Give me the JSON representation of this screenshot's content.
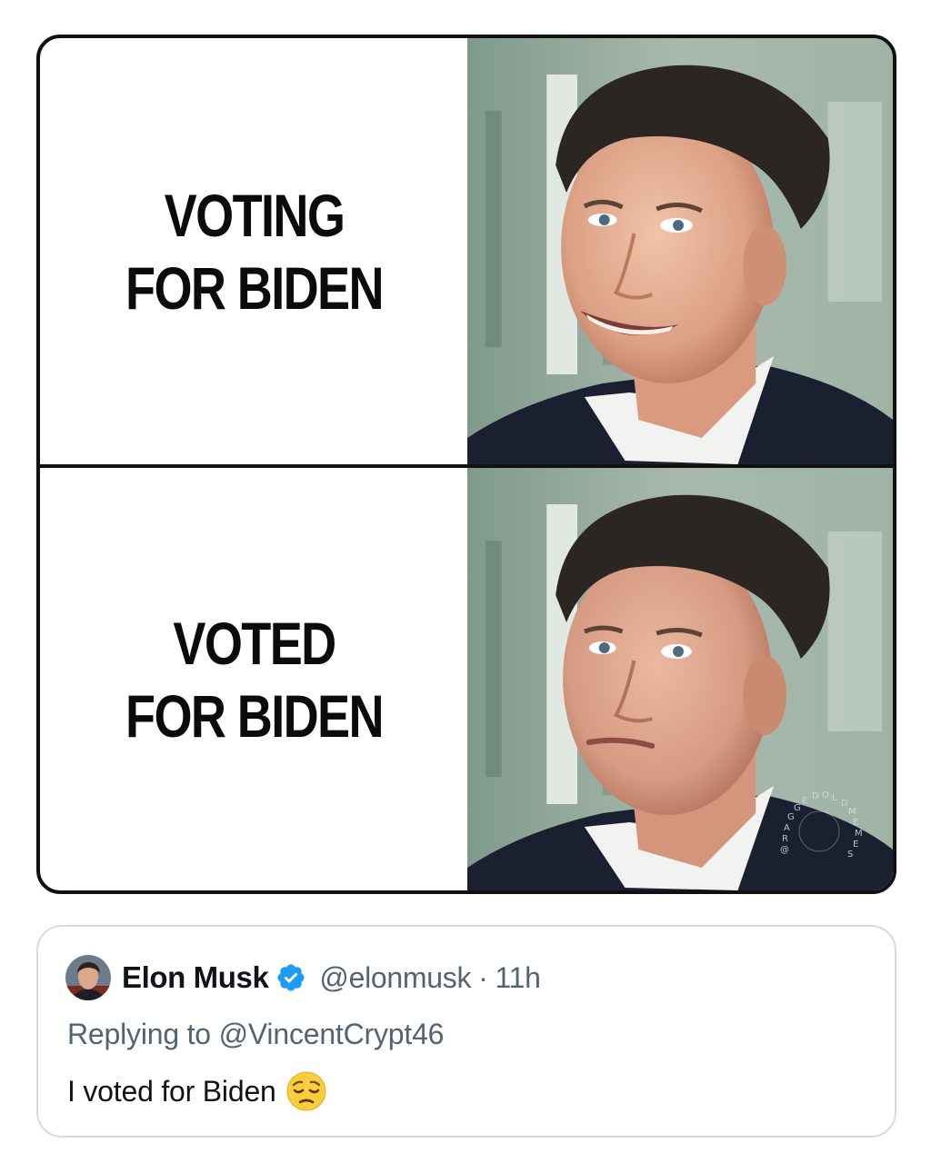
{
  "meme": {
    "top_caption": [
      "VOTING",
      "FOR BIDEN"
    ],
    "bottom_caption": [
      "VOTED",
      "FOR BIDEN"
    ],
    "top_photo": "smiling-man-photo",
    "bottom_photo": "solemn-man-photo",
    "watermark": "@RAGGEDOLDMEMES"
  },
  "tweet": {
    "author_name": "Elon Musk",
    "handle": "@elonmusk",
    "separator": "·",
    "time": "11h",
    "replying_to": "Replying to @VincentCrypt46",
    "text": "I voted for Biden",
    "emoji": "pensive-face-emoji",
    "verified_icon": "verified-badge-icon",
    "colors": {
      "verified": "#1d9bf0",
      "secondary_text": "#536471",
      "primary_text": "#0f1419"
    }
  }
}
